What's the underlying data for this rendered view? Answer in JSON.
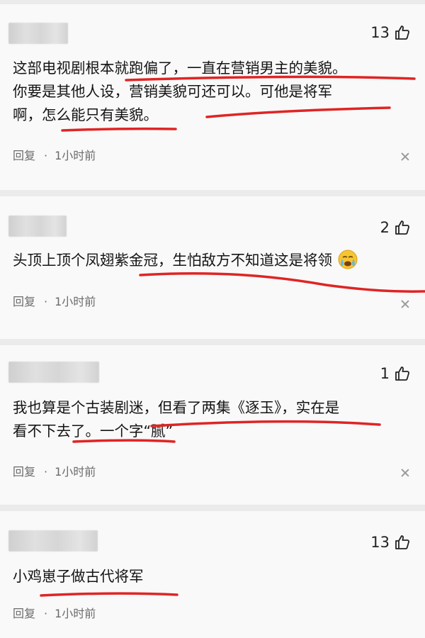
{
  "comments": [
    {
      "likes": "13",
      "lines": [
        "这部电视剧根本就跑偏了，一直在营销男主的美貌。",
        "你要是其他人设，营销美貌可还可以。可他是将军",
        "啊，怎么能只有美貌。"
      ],
      "reply": "回复",
      "sep": "·",
      "time": "1小时前"
    },
    {
      "likes": "2",
      "lines": [
        "头顶上顶个凤翅紫金冠，生怕敌方不知道这是将领"
      ],
      "reply": "回复",
      "sep": "·",
      "time": "1小时前"
    },
    {
      "likes": "1",
      "lines": [
        "我也算是个古装剧迷，但看了两集《逐玉》，实在是",
        "看不下去了。一个字“腻”"
      ],
      "reply": "回复",
      "sep": "·",
      "time": "1小时前"
    },
    {
      "likes": "13",
      "lines": [
        "小鸡崽子做古代将军"
      ],
      "reply": "回复",
      "sep": "·",
      "time": "1小时前"
    }
  ],
  "colors": {
    "underline": "#e02424",
    "background": "#f9f9f9",
    "separator": "#ebebeb"
  },
  "icons": {
    "like": "thumbs-up-icon",
    "close": "close-icon",
    "emoji": "crying-face-emoji"
  }
}
